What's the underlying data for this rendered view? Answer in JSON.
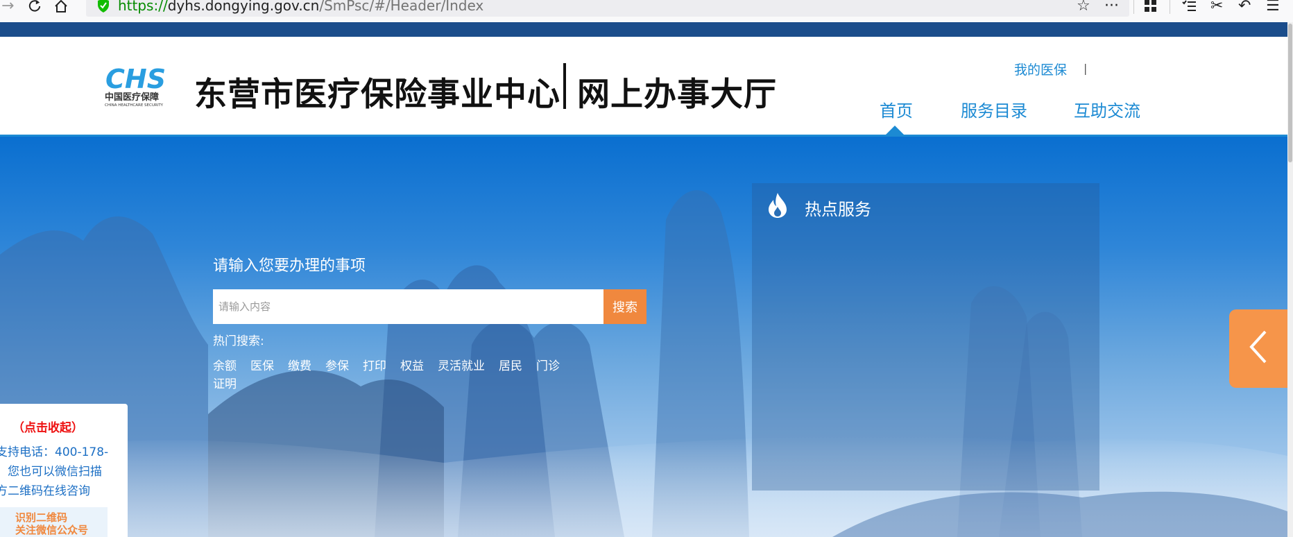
{
  "browser": {
    "url_scheme": "https://",
    "url_host": "dyhs.dongying.gov.cn",
    "url_path": "/SmPsc/#/Header/Index"
  },
  "header": {
    "logo_text": "CHS",
    "logo_cn": "中国医疗保障",
    "logo_en": "CHINA HEALTHCARE SECURITY",
    "title": "东营市医疗保险事业中心",
    "subtitle": "网上办事大厅",
    "my_link": "我的医保",
    "separator": "|",
    "nav": [
      {
        "label": "首页"
      },
      {
        "label": "服务目录"
      },
      {
        "label": "互助交流"
      }
    ]
  },
  "search": {
    "title": "请输入您要办理的事项",
    "placeholder": "请输入内容",
    "button_label": "搜索",
    "hot_label": "热门搜索:",
    "hot_tags": [
      "余额",
      "医保",
      "缴费",
      "参保",
      "打印",
      "权益",
      "灵活就业",
      "居民",
      "门诊",
      "证明"
    ]
  },
  "hot_services": {
    "title": "热点服务"
  },
  "float_panel": {
    "collapse_label": "（点击收起）",
    "lines": [
      "支持电话：400-178-",
      "，您也可以微信扫描",
      "方二维码在线咨询"
    ],
    "qr_line1": "识别二维码",
    "qr_line2": "关注微信公众号"
  },
  "colors": {
    "brand_blue": "#1c8ad3",
    "top_band": "#1b4d8b",
    "accent_orange": "#f0883e"
  }
}
